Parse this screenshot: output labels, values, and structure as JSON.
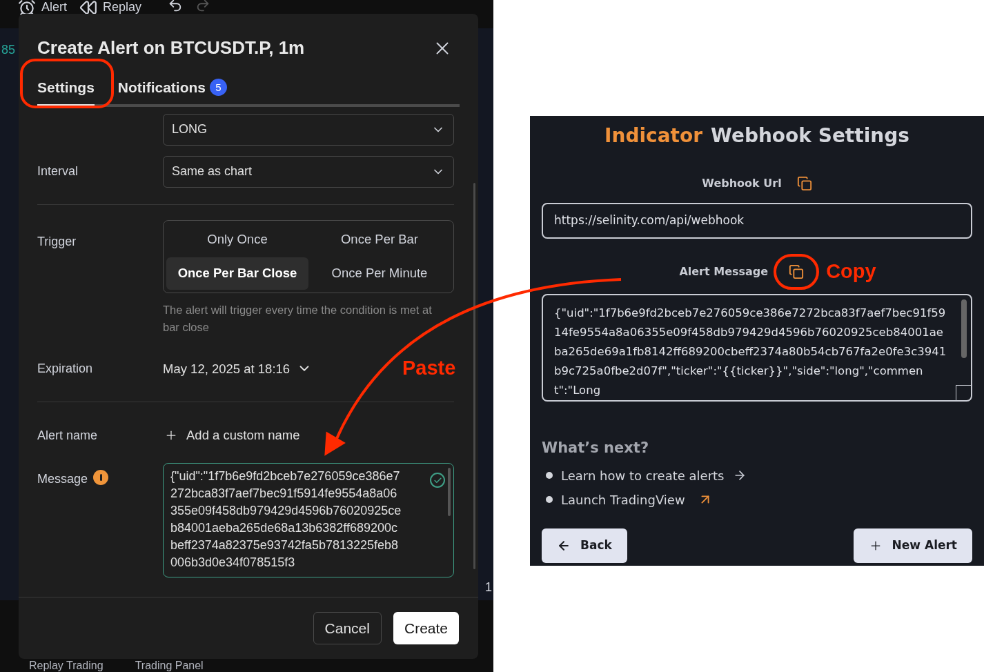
{
  "toolbar": {
    "items": [
      {
        "label": "Alert",
        "kind": "alarm"
      },
      {
        "label": "Replay",
        "kind": "replay"
      }
    ]
  },
  "chart": {
    "edge_labels": [
      "85",
      "1"
    ]
  },
  "dialog": {
    "title": "Create Alert on BTCUSDT.P, 1m",
    "tabs": [
      {
        "label": "Settings",
        "selected": true
      },
      {
        "label": "Notifications",
        "selected": false,
        "badge": "5"
      }
    ],
    "selects": [
      {
        "value": "LONG"
      },
      {
        "label": "Interval",
        "value": "Same as chart"
      }
    ],
    "trigger": {
      "label": "Trigger",
      "options": [
        {
          "label": "Only Once",
          "selected": false
        },
        {
          "label": "Once Per Bar",
          "selected": false
        },
        {
          "label": "Once Per Bar Close",
          "selected": true
        },
        {
          "label": "Once Per Minute",
          "selected": false
        }
      ],
      "hint": "The alert will trigger every time the condition is met at bar close"
    },
    "expiration": {
      "label": "Expiration",
      "value": "May 12, 2025 at 18:16"
    },
    "alert_name": {
      "label": "Alert name",
      "action": "Add a custom name"
    },
    "message": {
      "label": "Message",
      "warning": true,
      "valid": true,
      "value": "{\"uid\":\"1f7b6e9fd2bceb7e276059ce386e7272bca83f7aef7bec91f5914fe9554a8a06355e09f458db979429d4596b76020925ceb84001aeba265de68a13b6382ff689200cbeff2374a82375e93742fa5b7813225feb8006b3d0e34f078515f3"
    },
    "buttons": [
      {
        "label": "Cancel",
        "kind": "secondary"
      },
      {
        "label": "Create",
        "kind": "primary"
      }
    ]
  },
  "bottom_tabs": [
    "Replay Trading",
    "Trading Panel"
  ],
  "webhook_panel": {
    "title_accent": "Indicator",
    "title": "Webhook Settings",
    "url": {
      "label": "Webhook Url",
      "value": "https://selinity.com/api/webhook"
    },
    "message": {
      "label": "Alert Message",
      "value": "{\"uid\":\"1f7b6e9fd2bceb7e276059ce386e7272bca83f7aef7bec91f5914fe9554a8a06355e09f458db979429d4596b76020925ceb84001aeba265de69a1fb8142ff689200cbeff2374a80b54cb767fa2e0fe3c3941b9c725a0fbe2d07f\",\"ticker\":\"{{ticker}}\",\"side\":\"long\",\"comment\":\"Long"
    },
    "next": {
      "heading": "What’s next?",
      "links": [
        {
          "label": "Learn how to create alerts",
          "kind": "internal"
        },
        {
          "label": "Launch TradingView",
          "kind": "external"
        }
      ]
    },
    "buttons": [
      {
        "label": "Back",
        "kind": "back"
      },
      {
        "label": "New Alert",
        "kind": "new"
      }
    ]
  },
  "annotations": {
    "copy": "Copy",
    "paste": "Paste"
  }
}
